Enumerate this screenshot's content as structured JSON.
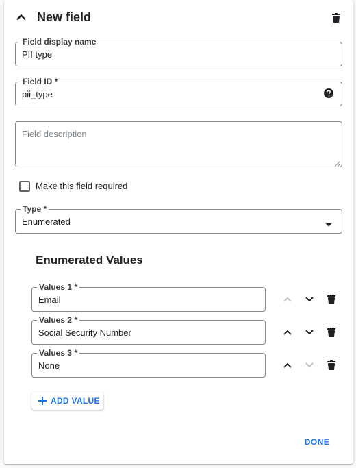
{
  "header": {
    "title": "New field",
    "collapse_icon": "chevron-up-icon",
    "delete_icon": "trash-icon"
  },
  "display_name": {
    "label": "Field display name",
    "value": "PII type"
  },
  "field_id": {
    "label": "Field ID *",
    "value": "pii_type",
    "help_icon": "help-circle-icon"
  },
  "description": {
    "placeholder": "Field description",
    "value": ""
  },
  "required": {
    "label": "Make this field required",
    "checked": false
  },
  "type": {
    "label": "Type *",
    "value": "Enumerated",
    "arrow_icon": "dropdown-arrow-icon"
  },
  "enum_section": {
    "title": "Enumerated Values",
    "values": [
      {
        "label": "Values 1 *",
        "value": "Email",
        "up_enabled": false,
        "down_enabled": true
      },
      {
        "label": "Values 2 *",
        "value": "Social Security Number",
        "up_enabled": true,
        "down_enabled": true
      },
      {
        "label": "Values 3 *",
        "value": "None",
        "up_enabled": true,
        "down_enabled": false
      }
    ]
  },
  "add_value_label": "ADD VALUE",
  "done_label": "DONE",
  "colors": {
    "accent": "#1a73e8",
    "icon_active": "#202124",
    "icon_disabled": "#bdc1c6",
    "border": "#80868b"
  }
}
